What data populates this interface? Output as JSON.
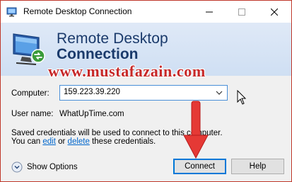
{
  "window": {
    "title": "Remote Desktop Connection",
    "controls": [
      "minimize-icon",
      "maximize-icon",
      "close-icon"
    ]
  },
  "banner": {
    "line1": "Remote Desktop",
    "line2": "Connection",
    "icon": "monitor-connection-icon"
  },
  "watermark": "www.mustafazain.com",
  "form": {
    "computer_label": "Computer:",
    "computer_value": "159.223.39.220",
    "username_label": "User name:",
    "username_value": "WhatUpTime.com",
    "credentials_line1": "Saved credentials will be used to connect to this computer.",
    "credentials_line2_prefix": "You can",
    "edit_link": "edit",
    "or_text": "or",
    "delete_link": "delete",
    "credentials_line2_suffix": "these credentials."
  },
  "footer": {
    "show_options_label": "Show Options",
    "connect_label": "Connect",
    "help_label": "Help"
  },
  "colors": {
    "accent": "#0078d7",
    "banner_text": "#1a3a6b",
    "watermark": "#c62828",
    "arrow": "#e53935"
  }
}
